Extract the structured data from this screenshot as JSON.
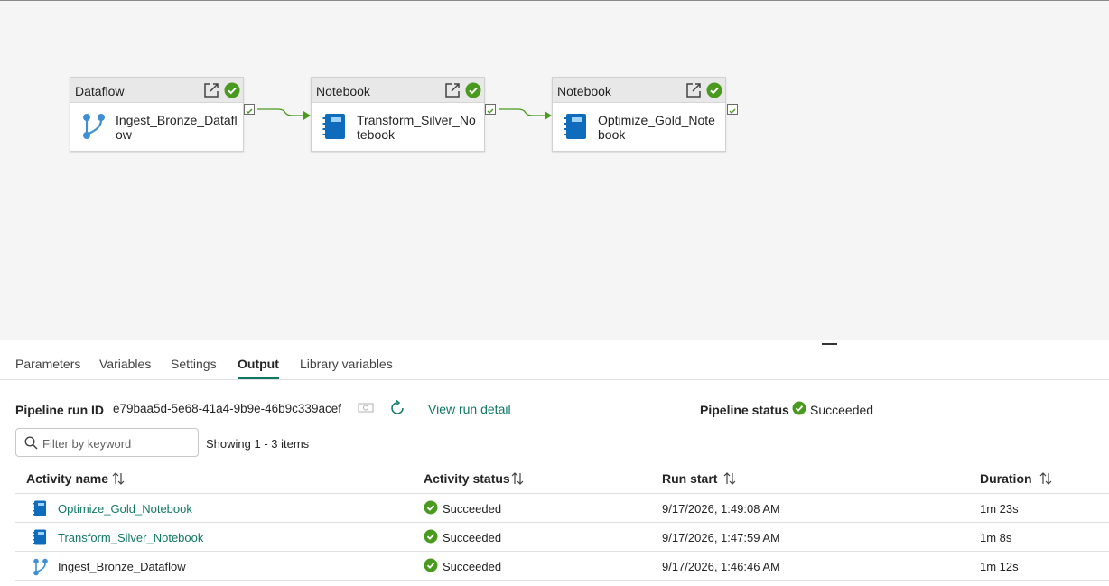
{
  "pipeline": {
    "nodes": [
      {
        "type": "Dataflow",
        "name": "Ingest_Bronze_Dataflow",
        "icon": "dataflow-icon"
      },
      {
        "type": "Notebook",
        "name": "Transform_Silver_Notebook",
        "icon": "notebook-icon"
      },
      {
        "type": "Notebook",
        "name": "Optimize_Gold_Notebook",
        "icon": "notebook-icon"
      }
    ]
  },
  "tabs": [
    "Parameters",
    "Variables",
    "Settings",
    "Output",
    "Library variables"
  ],
  "active_tab": "Output",
  "run": {
    "id_label": "Pipeline run ID",
    "id_value": "e79baa5d-5e68-41a4-9b9e-46b9c339acef",
    "view_detail": "View run detail",
    "status_label": "Pipeline status",
    "status_value": "Succeeded"
  },
  "filter": {
    "placeholder": "Filter by keyword",
    "showing": "Showing 1 - 3 items"
  },
  "table": {
    "headers": [
      "Activity name",
      "Activity status",
      "Run start",
      "Duration"
    ],
    "rows": [
      {
        "name": "Optimize_Gold_Notebook",
        "icon": "notebook-icon",
        "link": true,
        "status": "Succeeded",
        "start": "9/17/2026, 1:49:08 AM",
        "duration": "1m 23s"
      },
      {
        "name": "Transform_Silver_Notebook",
        "icon": "notebook-icon",
        "link": true,
        "status": "Succeeded",
        "start": "9/17/2026, 1:47:59 AM",
        "duration": "1m 8s"
      },
      {
        "name": "Ingest_Bronze_Dataflow",
        "icon": "dataflow-icon",
        "link": false,
        "status": "Succeeded",
        "start": "9/17/2026, 1:46:46 AM",
        "duration": "1m 12s"
      }
    ]
  },
  "colors": {
    "success": "#4a9a1f",
    "accent": "#117865",
    "notebook": "#0f6cbd",
    "dataflow": "#3f8fd6"
  }
}
